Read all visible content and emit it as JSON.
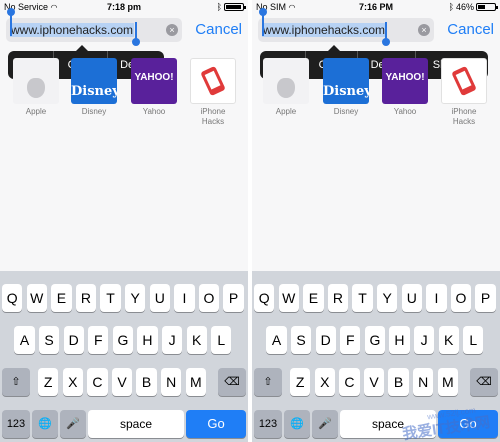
{
  "left": {
    "status": {
      "carrier": "No Service",
      "time": "7:18 pm",
      "battery_level": 0.95
    },
    "url": "www.iphonehacks.com",
    "cancel": "Cancel",
    "menu": [
      "Cut",
      "Copy",
      "Define"
    ],
    "favorites": [
      {
        "label": "Apple",
        "tile": "apple"
      },
      {
        "label": "Disney",
        "tile": "disney",
        "tile_text": "Disney"
      },
      {
        "label": "Yahoo",
        "tile": "yahoo",
        "tile_text": "YAHOO!"
      },
      {
        "label": "iPhone Hacks",
        "tile": "iph"
      }
    ]
  },
  "right": {
    "status": {
      "carrier": "No SIM",
      "time": "7:16 PM",
      "battery_text": "46%",
      "battery_level": 0.46
    },
    "url": "www.iphonehacks.com",
    "cancel": "Cancel",
    "menu": [
      "Cut",
      "Copy",
      "Define",
      "Share..."
    ],
    "favorites": [
      {
        "label": "Apple",
        "tile": "apple"
      },
      {
        "label": "Disney",
        "tile": "disney",
        "tile_text": "Disney"
      },
      {
        "label": "Yahoo",
        "tile": "yahoo",
        "tile_text": "YAHOO!"
      },
      {
        "label": "iPhone Hacks",
        "tile": "iph"
      }
    ]
  },
  "keyboard": {
    "row1": [
      "Q",
      "W",
      "E",
      "R",
      "T",
      "Y",
      "U",
      "I",
      "O",
      "P"
    ],
    "row2": [
      "A",
      "S",
      "D",
      "F",
      "G",
      "H",
      "J",
      "K",
      "L"
    ],
    "row3": [
      "Z",
      "X",
      "C",
      "V",
      "B",
      "N",
      "M"
    ],
    "numbers": "123",
    "space": "space",
    "go": "Go"
  },
  "icons": {
    "shift": "shift-icon",
    "delete": "delete-icon",
    "globe": "globe-icon",
    "mic": "microphone-icon",
    "wifi": "wifi-icon",
    "bluetooth": "bluetooth-icon",
    "clear": "clear-text-icon"
  },
  "watermark": {
    "main": "我爱IT技术网",
    "sub": "www.52ij.com"
  },
  "colors": {
    "accent": "#1f7ef6",
    "selection": "#b7d2f4",
    "menu_bg": "#1e1e1e",
    "keyboard_bg": "#d1d5db"
  }
}
